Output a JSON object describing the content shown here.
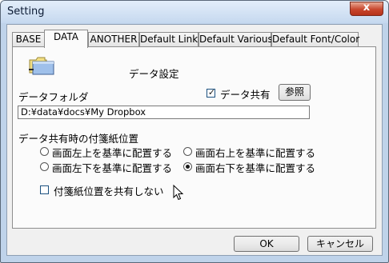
{
  "window": {
    "title": "Setting",
    "close_glyph": "x"
  },
  "tabs": [
    {
      "label": "BASE"
    },
    {
      "label": "DATA"
    },
    {
      "label": "ANOTHER"
    },
    {
      "label": "Default Link"
    },
    {
      "label": "Default Various"
    },
    {
      "label": "Default Font/Color"
    }
  ],
  "active_tab": "DATA",
  "data_panel": {
    "heading": "データ設定",
    "folder_label": "データフォルダ",
    "share_checkbox": {
      "label": "データ共有",
      "checked": true,
      "mark": "✓"
    },
    "browse_button": "参照",
    "folder_path": "D:¥data¥docs¥My Dropbox",
    "position_group": {
      "label": "データ共有時の付箋紙位置",
      "options": [
        {
          "label": "画面左上を基準に配置する",
          "checked": false
        },
        {
          "label": "画面右上を基準に配置する",
          "checked": false
        },
        {
          "label": "画面左下を基準に配置する",
          "checked": false
        },
        {
          "label": "画面右下を基準に配置する",
          "checked": true
        }
      ]
    },
    "no_share_position_checkbox": {
      "label": "付箋紙位置を共有しない",
      "checked": false
    }
  },
  "footer": {
    "ok": "OK",
    "cancel": "キャンセル"
  },
  "icons": {
    "folder": "folder-icon",
    "cursor": "mouse-cursor-icon",
    "close": "close-icon"
  },
  "colors": {
    "titlebar": "#c5d8ef",
    "close_button": "#c8462d",
    "panel_bg": "#fbfbfb"
  }
}
